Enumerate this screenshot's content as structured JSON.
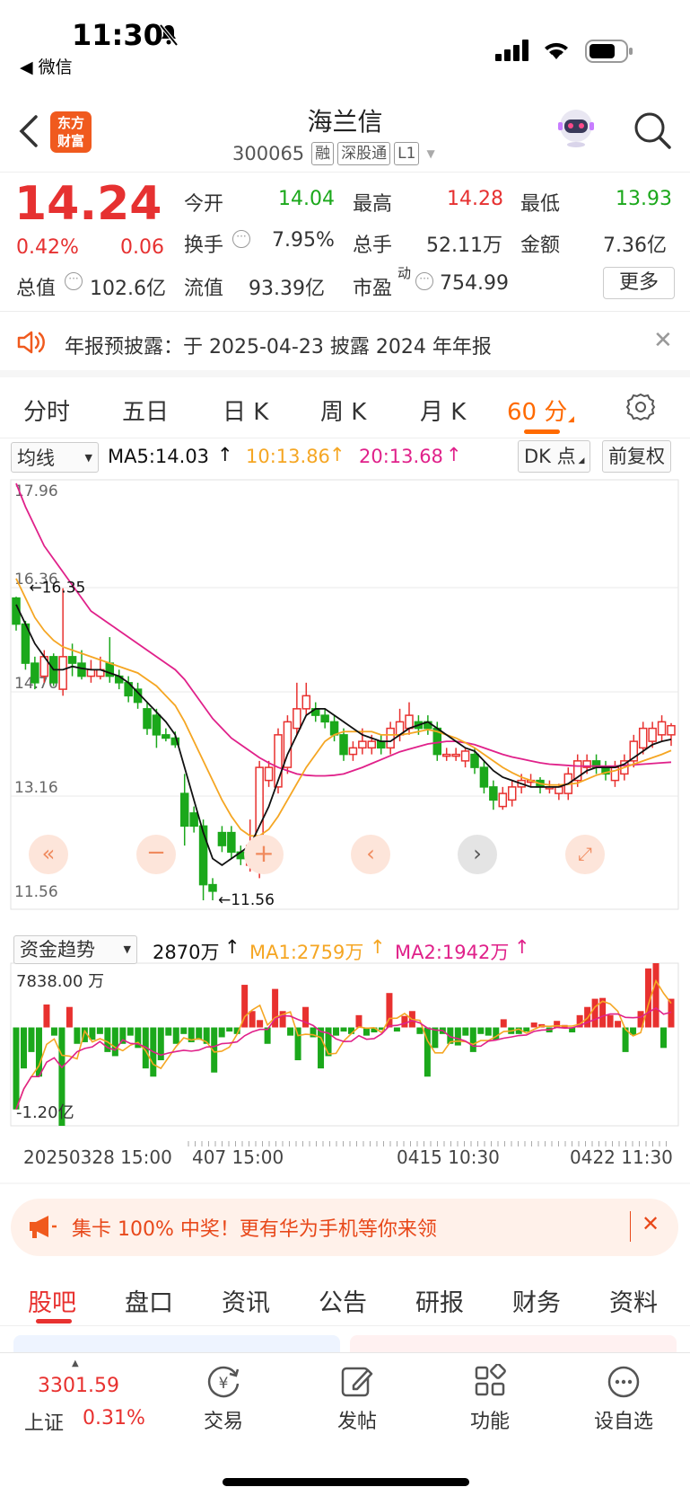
{
  "status": {
    "time": "11:30",
    "back_app": "◀ 微信"
  },
  "header": {
    "logo_line1": "东方",
    "logo_line2": "财富",
    "title": "海兰信",
    "code": "300065",
    "tags": [
      "融",
      "深股通",
      "L1"
    ]
  },
  "quote": {
    "price": "14.24",
    "change_pct": "0.42%",
    "change": "0.06",
    "open_label": "今开",
    "open": "14.04",
    "high_label": "最高",
    "high": "14.28",
    "low_label": "最低",
    "low": "13.93",
    "turnover_label": "换手",
    "turnover": "7.95%",
    "volume_label": "总手",
    "volume": "52.11万",
    "amount_label": "金额",
    "amount": "7.36亿",
    "mktcap_label": "总值",
    "mktcap": "102.6亿",
    "float_label": "流值",
    "float": "93.39亿",
    "pe_label": "市盈",
    "pe_sup": "动",
    "pe": "754.99",
    "more": "更多"
  },
  "notice": {
    "text": "年报预披露：于 2025-04-23 披露 2024 年年报"
  },
  "ktabs": {
    "items": [
      "分时",
      "五日",
      "日 K",
      "周 K",
      "月 K",
      "60 分"
    ],
    "active": 5
  },
  "chart_top": {
    "select": "均线",
    "ma5": "MA5:14.03",
    "ma10": "10:13.86",
    "ma20": "20:13.68",
    "dk": "DK 点",
    "fq": "前复权"
  },
  "colors": {
    "up": "#e8312f",
    "down": "#1ba81b",
    "ma5": "#111111",
    "ma10": "#f5a623",
    "ma20": "#e0218a",
    "accent": "#ff6a00"
  },
  "fund": {
    "select": "资金趋势",
    "value": "2870万",
    "ma1": "MA1:2759万",
    "ma2": "MA2:1942万",
    "top_label": "7838.00 万",
    "bottom_label": "-1.20亿"
  },
  "xaxis": {
    "labels": [
      "20250328 15:00",
      "407 15:00",
      "0415 10:30",
      "0422 11:30"
    ]
  },
  "chart_data": {
    "type": "candlestick",
    "y_ticks": [
      "17.96",
      "16.36",
      "14.76",
      "13.16",
      "11.56"
    ],
    "ylim": [
      11.56,
      17.96
    ],
    "annotations": {
      "high": "←16.35",
      "low": "←11.56"
    },
    "candles": [
      [
        16.2,
        15.8,
        16.22,
        15.7
      ],
      [
        15.8,
        15.2,
        15.85,
        15.1
      ],
      [
        15.2,
        14.9,
        15.3,
        14.8
      ],
      [
        15.0,
        15.3,
        15.4,
        14.9
      ],
      [
        15.3,
        14.9,
        15.35,
        14.85
      ],
      [
        14.8,
        15.3,
        16.35,
        14.7
      ],
      [
        15.3,
        15.2,
        15.5,
        15.0
      ],
      [
        15.2,
        15.0,
        15.4,
        14.95
      ],
      [
        15.0,
        15.1,
        15.25,
        14.9
      ],
      [
        15.0,
        15.1,
        15.3,
        14.95
      ],
      [
        15.2,
        15.0,
        15.6,
        14.9
      ],
      [
        15.0,
        14.9,
        15.1,
        14.8
      ],
      [
        14.9,
        14.7,
        15.0,
        14.6
      ],
      [
        14.8,
        14.6,
        14.9,
        14.5
      ],
      [
        14.5,
        14.2,
        14.6,
        14.1
      ],
      [
        14.4,
        14.1,
        14.5,
        13.9
      ],
      [
        14.1,
        14.05,
        14.2,
        14.0
      ],
      [
        14.05,
        13.95,
        14.15,
        13.9
      ],
      [
        13.2,
        12.7,
        13.5,
        12.4
      ],
      [
        12.9,
        12.7,
        13.0,
        12.6
      ],
      [
        12.7,
        11.8,
        12.8,
        11.56
      ],
      [
        11.8,
        11.7,
        11.9,
        11.56
      ],
      [
        12.6,
        12.4,
        12.7,
        12.3
      ],
      [
        12.6,
        12.3,
        12.7,
        12.2
      ],
      [
        12.3,
        12.2,
        12.4,
        12.1
      ],
      [
        12.1,
        12.4,
        12.8,
        12.0
      ],
      [
        12.2,
        13.6,
        13.7,
        11.9
      ],
      [
        13.4,
        13.6,
        13.7,
        13.3
      ],
      [
        13.3,
        14.1,
        14.2,
        13.2
      ],
      [
        13.6,
        14.3,
        14.4,
        13.5
      ],
      [
        14.2,
        14.5,
        14.9,
        14.1
      ],
      [
        14.5,
        14.7,
        14.9,
        14.4
      ],
      [
        14.5,
        14.4,
        14.6,
        14.3
      ],
      [
        14.4,
        14.3,
        14.5,
        14.2
      ],
      [
        14.3,
        14.1,
        14.4,
        14.0
      ],
      [
        14.1,
        13.8,
        14.2,
        13.7
      ],
      [
        13.8,
        13.9,
        14.0,
        13.7
      ],
      [
        13.9,
        14.0,
        14.2,
        13.8
      ],
      [
        13.9,
        14.0,
        14.1,
        13.8
      ],
      [
        14.0,
        13.9,
        14.1,
        13.8
      ],
      [
        13.9,
        14.2,
        14.3,
        13.8
      ],
      [
        14.1,
        14.3,
        14.5,
        14.0
      ],
      [
        14.2,
        14.4,
        14.6,
        14.1
      ],
      [
        14.3,
        14.2,
        14.4,
        14.1
      ],
      [
        14.3,
        14.2,
        14.4,
        14.1
      ],
      [
        14.2,
        13.8,
        14.3,
        13.7
      ],
      [
        13.8,
        13.8,
        13.9,
        13.7
      ],
      [
        13.8,
        13.8,
        13.9,
        13.7
      ],
      [
        13.7,
        13.85,
        13.9,
        13.6
      ],
      [
        13.8,
        13.6,
        13.9,
        13.5
      ],
      [
        13.6,
        13.3,
        13.7,
        13.2
      ],
      [
        13.3,
        13.1,
        13.4,
        12.95
      ],
      [
        13.0,
        13.2,
        13.3,
        12.95
      ],
      [
        13.1,
        13.3,
        13.4,
        13.0
      ],
      [
        13.3,
        13.4,
        13.5,
        13.2
      ],
      [
        13.4,
        13.4,
        13.5,
        13.3
      ],
      [
        13.4,
        13.3,
        13.45,
        13.2
      ],
      [
        13.3,
        13.3,
        13.4,
        13.2
      ],
      [
        13.2,
        13.3,
        13.35,
        13.1
      ],
      [
        13.2,
        13.5,
        13.6,
        13.1
      ],
      [
        13.4,
        13.7,
        13.8,
        13.3
      ],
      [
        13.6,
        13.7,
        13.8,
        13.5
      ],
      [
        13.7,
        13.6,
        13.8,
        13.5
      ],
      [
        13.6,
        13.5,
        13.7,
        13.4
      ],
      [
        13.4,
        13.6,
        13.7,
        13.3
      ],
      [
        13.5,
        13.7,
        13.8,
        13.4
      ],
      [
        13.7,
        14.0,
        14.1,
        13.6
      ],
      [
        13.9,
        14.2,
        14.3,
        13.8
      ],
      [
        14.0,
        14.2,
        14.3,
        13.9
      ],
      [
        14.1,
        14.3,
        14.4,
        14.0
      ],
      [
        14.1,
        14.24,
        14.28,
        13.93
      ]
    ],
    "ma5": [
      16.1,
      15.8,
      15.5,
      15.3,
      15.1,
      15.1,
      15.15,
      15.12,
      15.1,
      15.1,
      15.05,
      15.0,
      14.9,
      14.75,
      14.6,
      14.45,
      14.3,
      14.1,
      13.6,
      13.1,
      12.6,
      12.2,
      12.1,
      12.2,
      12.3,
      12.4,
      12.7,
      13.0,
      13.4,
      13.8,
      14.1,
      14.4,
      14.5,
      14.5,
      14.4,
      14.3,
      14.2,
      14.1,
      14.05,
      14.0,
      14.0,
      14.1,
      14.2,
      14.25,
      14.3,
      14.2,
      14.1,
      14.0,
      13.9,
      13.85,
      13.7,
      13.55,
      13.45,
      13.4,
      13.35,
      13.3,
      13.3,
      13.3,
      13.3,
      13.35,
      13.45,
      13.55,
      13.6,
      13.6,
      13.6,
      13.65,
      13.75,
      13.85,
      13.95,
      14.0,
      14.03
    ],
    "ma10": [
      16.5,
      16.2,
      15.9,
      15.7,
      15.55,
      15.45,
      15.4,
      15.35,
      15.3,
      15.25,
      15.2,
      15.15,
      15.1,
      15.05,
      14.95,
      14.85,
      14.7,
      14.55,
      14.3,
      14.0,
      13.7,
      13.4,
      13.1,
      12.85,
      12.65,
      12.55,
      12.55,
      12.65,
      12.85,
      13.1,
      13.35,
      13.6,
      13.8,
      14.0,
      14.1,
      14.15,
      14.15,
      14.15,
      14.15,
      14.1,
      14.1,
      14.1,
      14.12,
      14.15,
      14.18,
      14.15,
      14.1,
      14.05,
      13.98,
      13.9,
      13.8,
      13.7,
      13.6,
      13.52,
      13.45,
      13.4,
      13.35,
      13.33,
      13.33,
      13.34,
      13.36,
      13.42,
      13.48,
      13.52,
      13.55,
      13.6,
      13.65,
      13.7,
      13.75,
      13.8,
      13.86
    ],
    "ma20": [
      17.96,
      17.6,
      17.3,
      17.0,
      16.8,
      16.6,
      16.4,
      16.2,
      16.0,
      15.9,
      15.8,
      15.7,
      15.6,
      15.5,
      15.4,
      15.3,
      15.2,
      15.1,
      14.95,
      14.75,
      14.55,
      14.35,
      14.2,
      14.05,
      13.95,
      13.85,
      13.75,
      13.67,
      13.6,
      13.55,
      13.5,
      13.48,
      13.47,
      13.47,
      13.48,
      13.5,
      13.55,
      13.6,
      13.66,
      13.72,
      13.78,
      13.84,
      13.88,
      13.92,
      13.96,
      13.98,
      14.0,
      14.0,
      13.98,
      13.95,
      13.9,
      13.85,
      13.8,
      13.76,
      13.73,
      13.7,
      13.67,
      13.65,
      13.64,
      13.63,
      13.62,
      13.62,
      13.62,
      13.62,
      13.62,
      13.63,
      13.64,
      13.65,
      13.66,
      13.67,
      13.68
    ],
    "fund_ylim": [
      -12000,
      7838
    ],
    "fund_bars": [
      -10000,
      -5000,
      -3000,
      -6000,
      2800,
      -1000,
      -12000,
      2500,
      -2000,
      -1800,
      -1500,
      -800,
      -3000,
      -3500,
      -2000,
      -1000,
      -2500,
      -5000,
      -6000,
      -4000,
      -1000,
      -2000,
      -800,
      -1800,
      -1500,
      -2000,
      -5500,
      -1200,
      -500,
      -800,
      5200,
      2000,
      900,
      -2000,
      4700,
      2000,
      -1000,
      -4000,
      2500,
      -1200,
      -5000,
      -3500,
      -1000,
      -500,
      -800,
      1500,
      -1000,
      -600,
      -300,
      4200,
      -500,
      1400,
      2000,
      -800,
      -6000,
      -2500,
      -800,
      -2000,
      -2200,
      -1000,
      -3000,
      -800,
      -1000,
      -1500,
      1000,
      -800,
      -800,
      -500,
      600,
      400,
      -600,
      800,
      300,
      -600,
      1500,
      2500,
      3500,
      3600,
      1500,
      800,
      -3000,
      -900,
      2000,
      7200,
      7838,
      -2500,
      3500
    ]
  },
  "promo": {
    "text": "集卡 100% 中奖！更有华为手机等你来领"
  },
  "tabs2": {
    "items": [
      "股吧",
      "盘口",
      "资讯",
      "公告",
      "研报",
      "财务",
      "资料"
    ],
    "active": 0
  },
  "bottom": {
    "index_value": "3301.59",
    "index_name": "上证",
    "index_pct": "0.31%",
    "trade": "交易",
    "post": "发帖",
    "func": "功能",
    "watch": "设自选"
  }
}
